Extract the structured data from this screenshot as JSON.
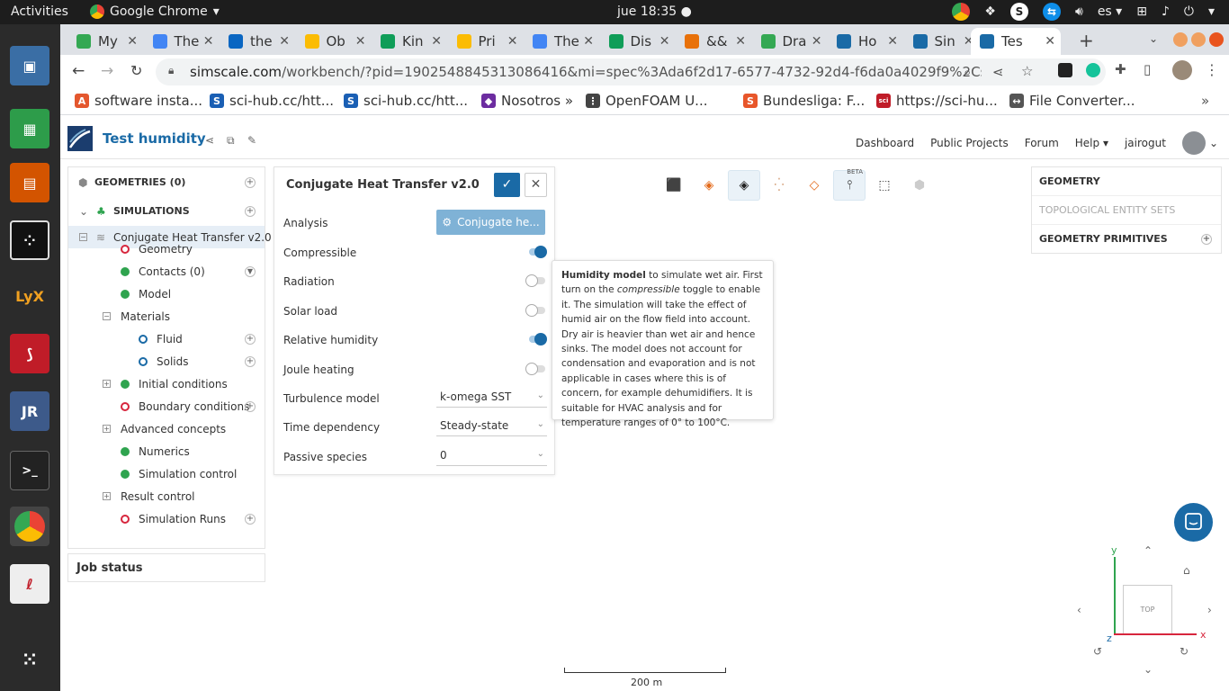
{
  "os": {
    "activities": "Activities",
    "app_name": "Google Chrome",
    "clock": "jue 18:35 ●",
    "lang": "es"
  },
  "browser": {
    "tabs": [
      {
        "label": "My",
        "color": "#34a853"
      },
      {
        "label": "The",
        "color": "#4285f4"
      },
      {
        "label": "the",
        "color": "#0a66c2"
      },
      {
        "label": "Ob",
        "color": "#fbbc04"
      },
      {
        "label": "Kin",
        "color": "#0f9d58"
      },
      {
        "label": "Pri",
        "color": "#fbbc04"
      },
      {
        "label": "The",
        "color": "#4285f4"
      },
      {
        "label": "Dis",
        "color": "#0f9d58"
      },
      {
        "label": "&&",
        "color": "#e8710a"
      },
      {
        "label": "Dra",
        "color": "#34a853"
      },
      {
        "label": "Ho",
        "color": "#1a6aa6"
      },
      {
        "label": "Sin",
        "color": "#1a6aa6"
      },
      {
        "label": "Tes",
        "color": "#1a6aa6"
      }
    ],
    "url_domain": "simscale.com",
    "url_rest": "/workbench/?pid=1902548845313086416&mi=spec%3Ada6f2d17-6577-4732-92d4-f6da0a4029f9%2Cservice%3ASIMU...",
    "bookmarks": [
      {
        "label": "software insta...",
        "icon": "A",
        "color": "#e4572e"
      },
      {
        "label": "sci-hub.cc/htt...",
        "icon": "S",
        "color": "#1a5fb4"
      },
      {
        "label": "sci-hub.cc/htt...",
        "icon": "S",
        "color": "#1a5fb4"
      },
      {
        "label": "Nosotros »",
        "icon": "◆",
        "color": "#6c2ca0"
      },
      {
        "label": "OpenFOAM U...",
        "icon": "⋮",
        "color": "#444"
      },
      {
        "label": "Bundesliga: F...",
        "icon": "S",
        "color": "#e8562a"
      },
      {
        "label": "https://sci-hu...",
        "icon": "sci",
        "color": "#c01c28"
      },
      {
        "label": "File Converter...",
        "icon": "↔",
        "color": "#555"
      }
    ]
  },
  "app": {
    "project_title": "Test humidity",
    "nav": [
      "Dashboard",
      "Public Projects",
      "Forum",
      "Help",
      "jairogut"
    ]
  },
  "tree": {
    "geometries": "GEOMETRIES (0)",
    "simulations": "SIMULATIONS",
    "sim_name": "Conjugate Heat Transfer v2.0",
    "items": [
      {
        "label": "Geometry",
        "status": "red"
      },
      {
        "label": "Contacts (0)",
        "status": "green"
      },
      {
        "label": "Model",
        "status": "green"
      },
      {
        "label": "Materials",
        "status": "none"
      },
      {
        "label": "Fluid",
        "status": "blue"
      },
      {
        "label": "Solids",
        "status": "blue"
      },
      {
        "label": "Initial conditions",
        "status": "green"
      },
      {
        "label": "Boundary conditions",
        "status": "red"
      },
      {
        "label": "Advanced concepts",
        "status": "none"
      },
      {
        "label": "Numerics",
        "status": "green"
      },
      {
        "label": "Simulation control",
        "status": "green"
      },
      {
        "label": "Result control",
        "status": "none"
      },
      {
        "label": "Simulation Runs",
        "status": "red"
      }
    ],
    "job_status": "Job status"
  },
  "panel": {
    "title": "Conjugate Heat Transfer v2.0",
    "analysis_label": "Analysis",
    "analysis_button": "Conjugate he...",
    "compressible": "Compressible",
    "radiation": "Radiation",
    "solar_load": "Solar load",
    "relative_humidity": "Relative humidity",
    "joule_heating": "Joule heating",
    "turbulence_label": "Turbulence model",
    "turbulence_value": "k-omega SST",
    "time_label": "Time dependency",
    "time_value": "Steady-state",
    "passive_label": "Passive species",
    "passive_value": "0",
    "toggles": {
      "compressible": true,
      "radiation": false,
      "solar_load": false,
      "relative_humidity": true,
      "joule_heating": false
    }
  },
  "tooltip": {
    "bold": "Humidity model",
    "text1": " to simulate wet air. First turn on the ",
    "italic": "compressible",
    "text2": " toggle to enable it. The simulation will take the effect of humid air on the flow field into account. Dry air is heavier than wet air and hence sinks. The model does not account for condensation and evaporation and is not applicable in cases where this is of concern, for example dehumidifiers. It is suitable for HVAC analysis and for temperature ranges of 0° to 100°C."
  },
  "viewer": {
    "beta": "BETA",
    "right_panel": [
      "GEOMETRY",
      "TOPOLOGICAL ENTITY SETS",
      "GEOMETRY PRIMITIVES"
    ],
    "scale_label": "200 m",
    "cube_label": "TOP",
    "axis_y": "y",
    "axis_x": "x",
    "axis_z": "z"
  }
}
